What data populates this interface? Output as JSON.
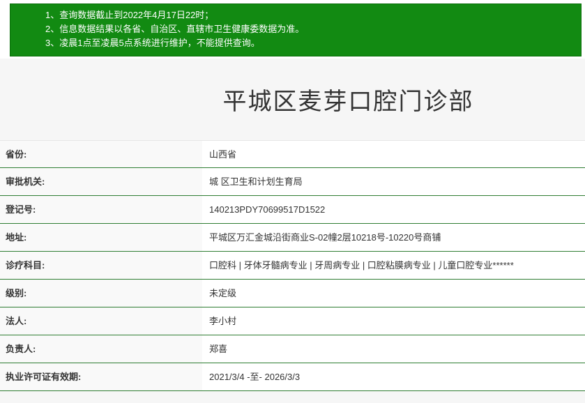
{
  "notice": {
    "lines": [
      "1、查询数据截止到2022年4月17日22时；",
      "2、信息数据结果以各省、自治区、直辖市卫生健康委数据为准。",
      "3、凌晨1点至凌晨5点系统进行维护，不能提供查询。"
    ]
  },
  "page": {
    "title": "平城区麦芽口腔门诊部"
  },
  "rows": [
    {
      "label": "省份:",
      "value": "山西省"
    },
    {
      "label": "审批机关:",
      "value": "城 区卫生和计划生育局"
    },
    {
      "label": "登记号:",
      "value": "140213PDY70699517D1522"
    },
    {
      "label": "地址:",
      "value": "平城区万汇金城沿街商业S-02幢2层10218号-10220号商铺"
    },
    {
      "label": "诊疗科目:",
      "value": "口腔科 | 牙体牙髓病专业 | 牙周病专业 | 口腔粘膜病专业 | 儿童口腔专业******"
    },
    {
      "label": "级别:",
      "value": "未定级"
    },
    {
      "label": "法人:",
      "value": "李小村"
    },
    {
      "label": "负责人:",
      "value": "郑喜"
    },
    {
      "label": "执业许可证有效期:",
      "value": "2021/3/4 -至- 2026/3/3"
    }
  ],
  "colors": {
    "notice_bg": "#128a12",
    "row_divider": "#2e7d32"
  }
}
